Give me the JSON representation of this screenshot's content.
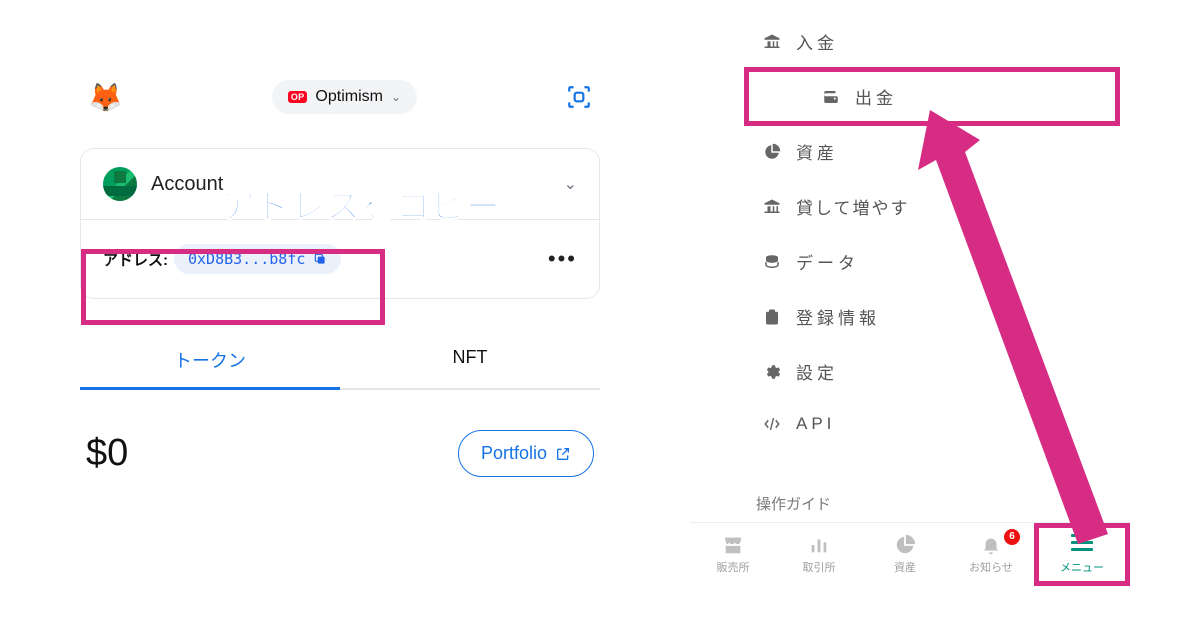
{
  "annotations": {
    "copy_address": "アドレスをコピー"
  },
  "metamask": {
    "network": {
      "badge": "OP",
      "name": "Optimism"
    },
    "account": {
      "name": "Account"
    },
    "address": {
      "label": "アドレス:",
      "value": "0xD8B3...b8fc"
    },
    "tabs": [
      {
        "label": "トークン",
        "active": true
      },
      {
        "label": "NFT",
        "active": false
      }
    ],
    "balance": "$0",
    "portfolio_label": "Portfolio"
  },
  "exchange": {
    "menu": [
      {
        "icon": "bank",
        "label": "入金",
        "highlight": false
      },
      {
        "icon": "wallet",
        "label": "出金",
        "highlight": true
      },
      {
        "icon": "pie",
        "label": "資産",
        "highlight": false
      },
      {
        "icon": "bank",
        "label": "貸して増やす",
        "highlight": false,
        "tight": true
      },
      {
        "icon": "stack",
        "label": "データ",
        "highlight": false
      },
      {
        "icon": "clipboard",
        "label": "登録情報",
        "highlight": false
      },
      {
        "icon": "gear",
        "label": "設定",
        "highlight": false
      },
      {
        "icon": "api",
        "label": "API",
        "highlight": false
      }
    ],
    "guide_label": "操作ガイド",
    "bottom_nav": [
      {
        "icon": "store",
        "label": "販売所",
        "active": false
      },
      {
        "icon": "chart",
        "label": "取引所",
        "active": false
      },
      {
        "icon": "pie",
        "label": "資産",
        "active": false
      },
      {
        "icon": "bell",
        "label": "お知らせ",
        "active": false,
        "badge": "6"
      },
      {
        "icon": "menu",
        "label": "メニュー",
        "active": true,
        "highlight": true
      }
    ]
  }
}
